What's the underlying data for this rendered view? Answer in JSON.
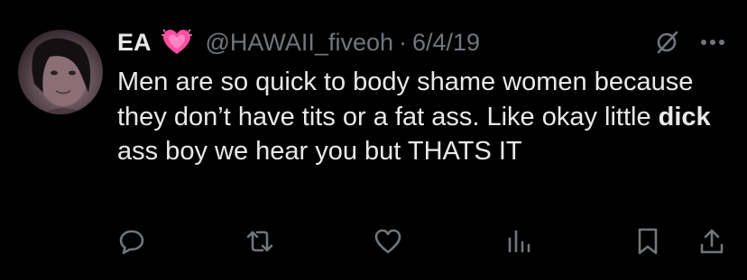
{
  "tweet": {
    "author_name": "EA",
    "handle": "@HAWAII_fiveoh",
    "separator": "·",
    "date": "6/4/19",
    "text_part1": "Men are so quick to body shame women because they don’t have tits or a fat ass. Like okay little ",
    "text_bold": "dick",
    "text_part2": " ass boy we hear you but THATS IT"
  },
  "icons": {
    "heart_emoji": "sparkling-heart-icon",
    "header_right": [
      "grok-slash-icon",
      "more-icon"
    ],
    "actions": [
      "reply-icon",
      "retweet-icon",
      "like-icon",
      "views-icon",
      "bookmark-icon",
      "share-icon"
    ]
  },
  "colors": {
    "background": "#000000",
    "text_primary": "#e7e9ea",
    "text_secondary": "#71767b",
    "heart_pink": "#ff4fa3"
  }
}
